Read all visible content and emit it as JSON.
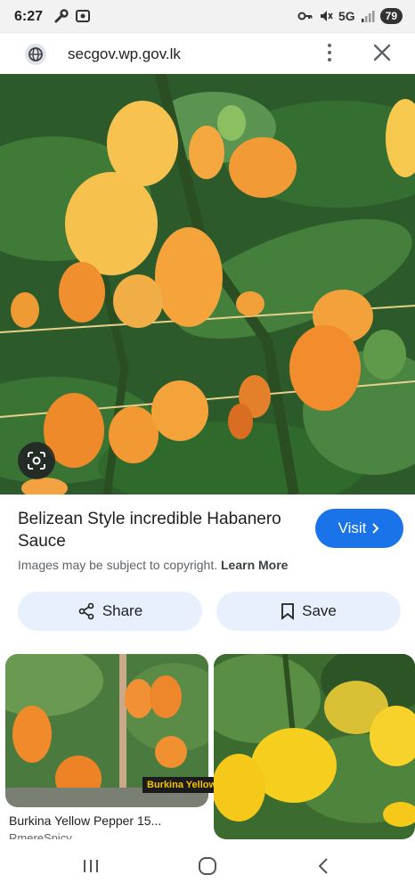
{
  "status_bar": {
    "time": "6:27",
    "network": "5G",
    "battery": "79",
    "left_icons": [
      "wrench-icon",
      "screen-record-icon"
    ],
    "right_icons": [
      "key-icon",
      "mute-icon",
      "signal-icon"
    ]
  },
  "browser": {
    "url": "secgov.wp.gov.lk",
    "icons": [
      "site-globe-icon",
      "more-options-icon",
      "close-icon"
    ]
  },
  "result": {
    "title": "Belizean Style incredible Habanero Sauce",
    "visit_label": "Visit",
    "copyright_text": "Images may be subject to copyright.",
    "learn_more": "Learn More",
    "share_label": "Share",
    "save_label": "Save"
  },
  "related": [
    {
      "caption": "Burkina Yellow Pepper 15...",
      "source": "RmereSpicy",
      "overlay_label": "Burkina Yellow"
    },
    {
      "caption": "",
      "source": ""
    }
  ],
  "nav_icons": [
    "recents-icon",
    "home-icon",
    "back-icon"
  ],
  "colors": {
    "accent": "#1a73e8",
    "pill_bg": "#e8f0fe",
    "leaf": "#2f6b2e",
    "pepper_orange": "#f29b38",
    "pepper_yellow": "#f7c948"
  }
}
